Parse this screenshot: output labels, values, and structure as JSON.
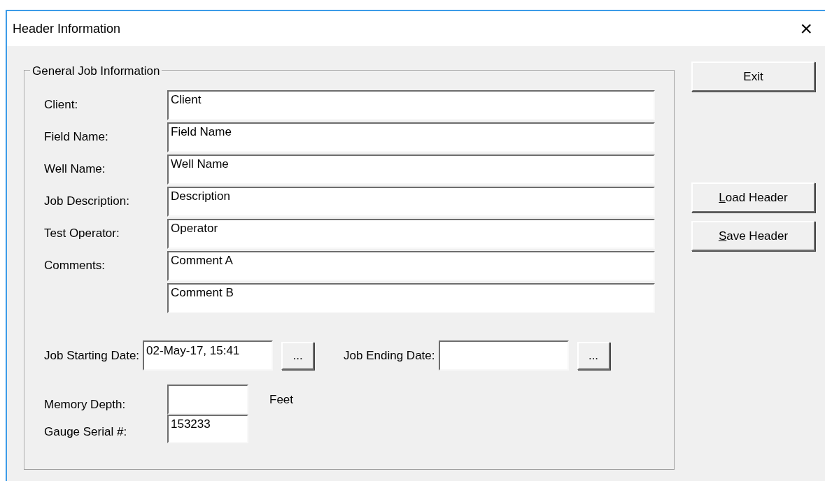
{
  "window": {
    "title": "Header Information",
    "close": "×"
  },
  "group": {
    "legend": "General Job Information",
    "fields": [
      {
        "label": "Client:",
        "value": "Client"
      },
      {
        "label": "Field Name:",
        "value": "Field Name"
      },
      {
        "label": "Well Name:",
        "value": "Well Name"
      },
      {
        "label": "Job Description:",
        "value": "Description"
      },
      {
        "label": "Test Operator:",
        "value": "Operator"
      },
      {
        "label": "Comments:",
        "value": "Comment A"
      },
      {
        "value": "Comment B"
      }
    ],
    "dates": [
      {
        "label": "Job Starting Date:",
        "value": "02-May-17, 15:41",
        "button": "..."
      },
      {
        "label": "Job Ending Date:",
        "button": "..."
      }
    ],
    "memory_depth": {
      "label": "Memory Depth:",
      "unit": "Feet"
    },
    "gauge_serial": {
      "label": "Gauge Serial #:",
      "value": "153233"
    }
  },
  "buttons": [
    {
      "label": "Exit",
      "underline_first": false
    },
    {
      "label": "Load Header",
      "underline_first": true
    },
    {
      "label": "Save Header",
      "underline_first": true
    }
  ]
}
